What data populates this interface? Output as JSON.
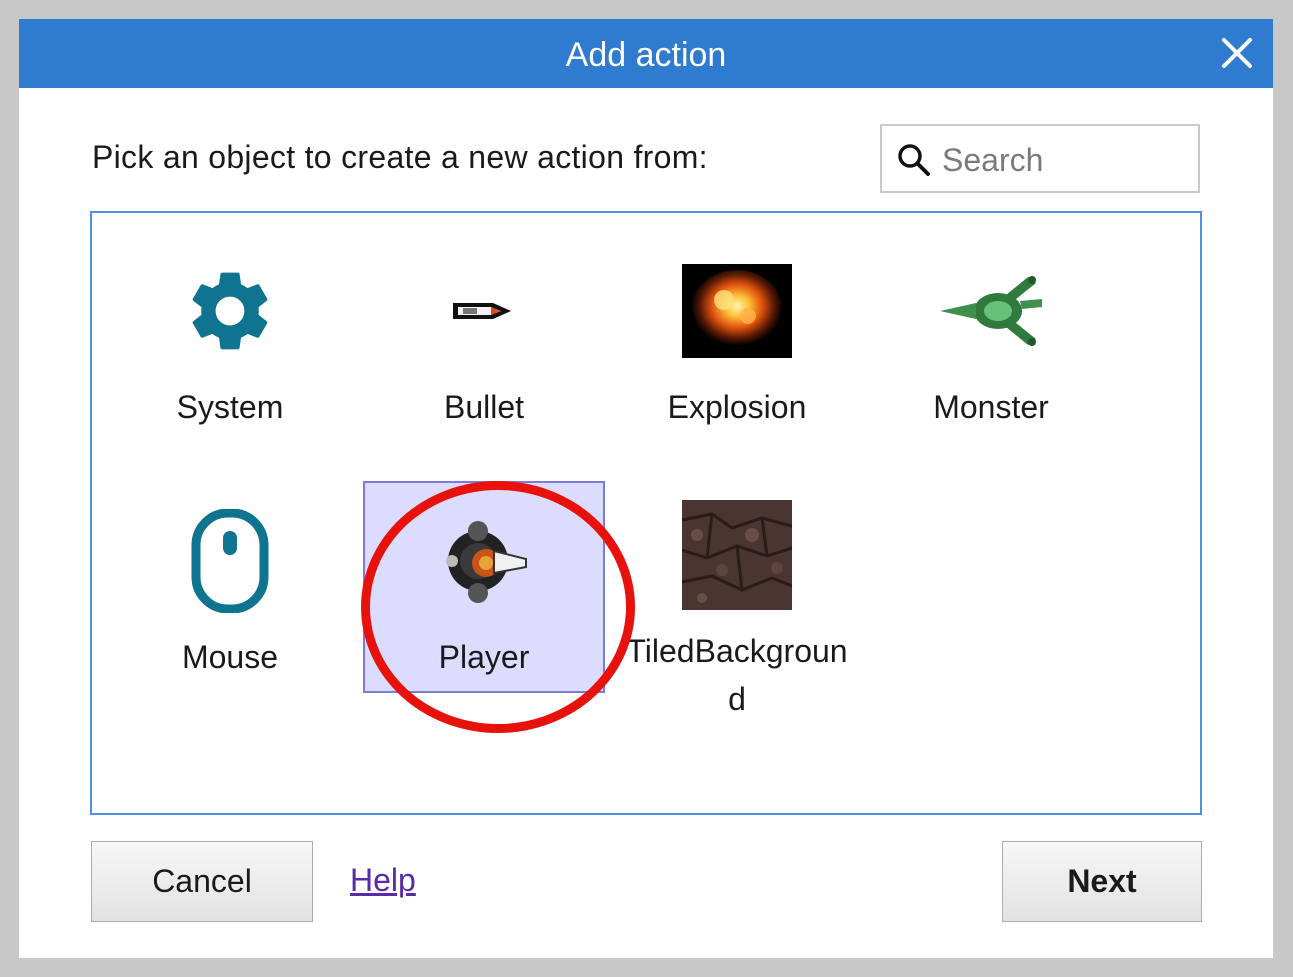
{
  "dialog": {
    "title": "Add action",
    "prompt": "Pick an object to create a new action from:",
    "search": {
      "placeholder": "Search",
      "value": ""
    },
    "objects": [
      {
        "label": "System",
        "icon": "gear-icon"
      },
      {
        "label": "Bullet",
        "icon": "bullet-sprite-icon"
      },
      {
        "label": "Explosion",
        "icon": "explosion-sprite-icon"
      },
      {
        "label": "Monster",
        "icon": "monster-sprite-icon"
      },
      {
        "label": "Mouse",
        "icon": "mouse-icon"
      },
      {
        "label": "Player",
        "icon": "player-sprite-icon",
        "selected": true
      },
      {
        "label": "TiledBackground",
        "icon": "tiled-background-icon"
      }
    ],
    "buttons": {
      "cancel": "Cancel",
      "help": "Help",
      "next": "Next"
    }
  },
  "colors": {
    "titlebar": "#2e7bcf",
    "accent_teal": "#0e7490",
    "selection_bg": "#dcdcff",
    "selection_border": "#7b7bdc",
    "highlight_ring": "#e8120d",
    "link": "#5a2ba8"
  }
}
